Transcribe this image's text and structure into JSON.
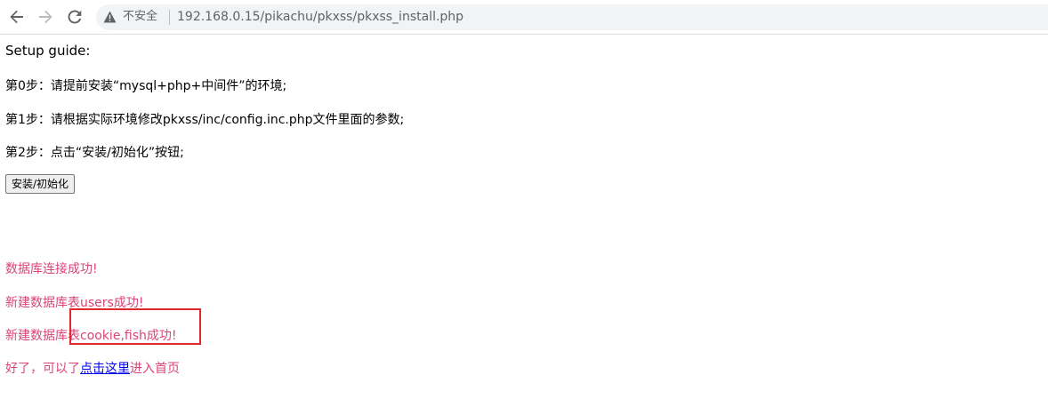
{
  "browser": {
    "security_label": "不安全",
    "url": "192.168.0.15/pikachu/pkxss/pkxss_install.php"
  },
  "page": {
    "title": "Setup guide:",
    "steps": [
      "第0步：请提前安装“mysql+php+中间件”的环境;",
      "第1步：请根据实际环境修改pkxss/inc/config.inc.php文件里面的参数;",
      "第2步：点击“安装/初始化”按钮;"
    ],
    "install_button_label": "安装/初始化",
    "messages": [
      "数据库连接成功!",
      "新建数据库表users成功!",
      "新建数据库表cookie,fish成功!"
    ],
    "final_message": {
      "prefix": "好了，可以了",
      "link_text": "点击这里",
      "suffix": "进入首页"
    }
  },
  "colors": {
    "message": "#d9447a",
    "link": "#0000ee",
    "highlight_box": "#e0282d"
  },
  "icons": [
    "back-arrow-icon",
    "forward-arrow-icon",
    "reload-icon",
    "warning-triangle-icon"
  ]
}
